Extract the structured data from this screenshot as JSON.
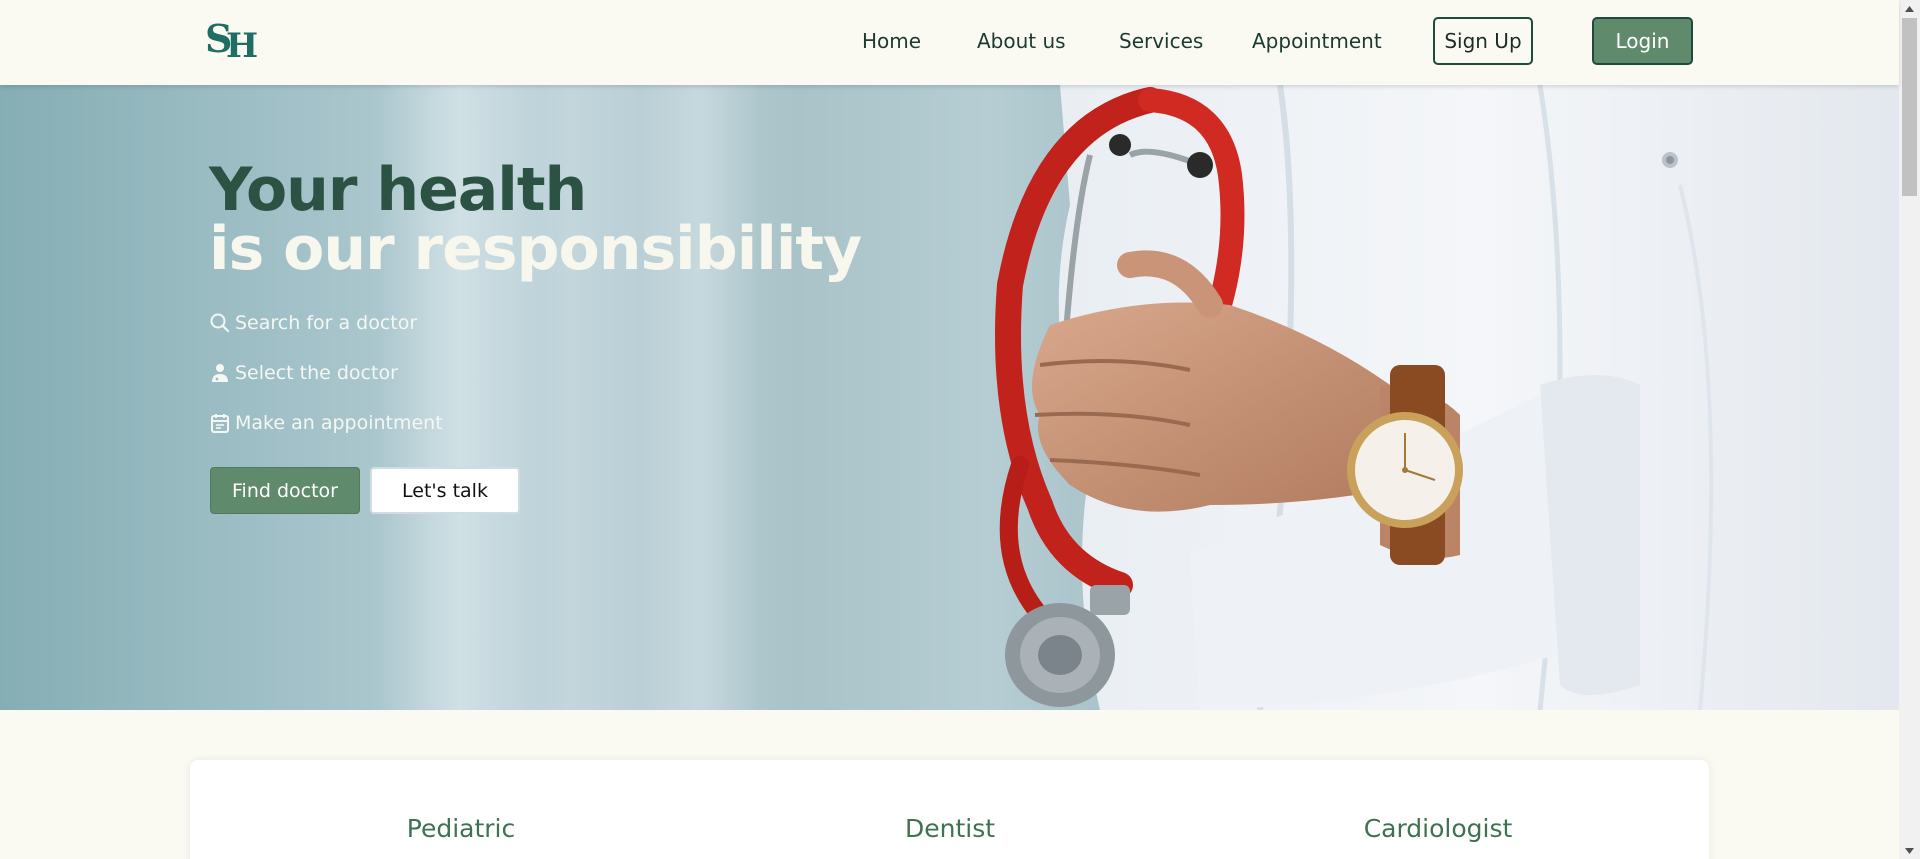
{
  "header": {
    "logo_letters": "SH",
    "nav": [
      {
        "label": "Home"
      },
      {
        "label": "About us"
      },
      {
        "label": "Services"
      },
      {
        "label": "Appointment"
      }
    ],
    "signup_label": "Sign Up",
    "login_label": "Login"
  },
  "hero": {
    "title_line1": "Your health",
    "title_line2": "is our responsibility",
    "steps": [
      {
        "icon": "search-icon",
        "label": "Search for a doctor"
      },
      {
        "icon": "doctor-icon",
        "label": "Select the doctor"
      },
      {
        "icon": "calendar-icon",
        "label": "Make an appointment"
      }
    ],
    "find_button": "Find doctor",
    "talk_button": "Let's talk"
  },
  "specialties": [
    {
      "label": "Pediatric"
    },
    {
      "label": "Dentist"
    },
    {
      "label": "Cardiologist"
    }
  ],
  "colors": {
    "primary_green": "#5f8a6b",
    "dark_green": "#2c5244",
    "heading_green": "#3e7352",
    "background": "#fafaf3"
  }
}
